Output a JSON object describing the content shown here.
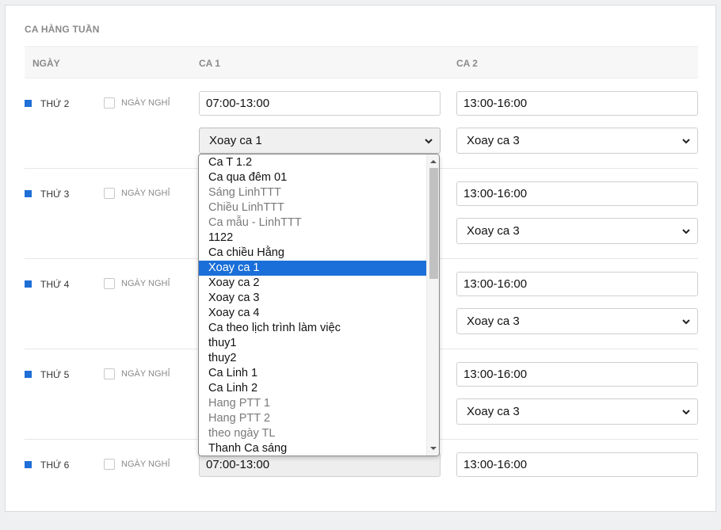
{
  "section_title": "CA HÀNG TUẦN",
  "columns": {
    "day": "NGÀY",
    "shift1": "CA 1",
    "shift2": "CA 2"
  },
  "off_label": "NGÀY NGHỈ",
  "days": [
    {
      "label": "THỨ 2",
      "shift1_time": "07:00-13:00",
      "shift2_time": "13:00-16:00",
      "shift1_select": "Xoay ca 1",
      "shift2_select": "Xoay ca 3"
    },
    {
      "label": "THỨ 3",
      "shift2_time": "13:00-16:00",
      "shift2_select": "Xoay ca 3"
    },
    {
      "label": "THỨ 4",
      "shift2_time": "13:00-16:00",
      "shift2_select": "Xoay ca 3"
    },
    {
      "label": "THỨ 5",
      "shift2_time": "13:00-16:00",
      "shift2_select": "Xoay ca 3"
    },
    {
      "label": "THỨ 6",
      "shift1_time": "07:00-13:00",
      "shift2_time": "13:00-16:00"
    }
  ],
  "dropdown_options": [
    {
      "label": "Ca T 1.2",
      "state": "normal"
    },
    {
      "label": "Ca qua đêm 01",
      "state": "normal"
    },
    {
      "label": "Sáng LinhTTT",
      "state": "dim"
    },
    {
      "label": "Chiều LinhTTT",
      "state": "dim"
    },
    {
      "label": "Ca mẫu - LinhTTT",
      "state": "dim"
    },
    {
      "label": "1122",
      "state": "normal"
    },
    {
      "label": "Ca chiều Hằng",
      "state": "normal"
    },
    {
      "label": "Xoay ca 1",
      "state": "selected"
    },
    {
      "label": "Xoay ca 2",
      "state": "normal"
    },
    {
      "label": "Xoay ca 3",
      "state": "normal"
    },
    {
      "label": "Xoay ca 4",
      "state": "normal"
    },
    {
      "label": "Ca theo lịch trình làm việc",
      "state": "normal"
    },
    {
      "label": "thuy1",
      "state": "normal"
    },
    {
      "label": "thuy2",
      "state": "normal"
    },
    {
      "label": "Ca Linh 1",
      "state": "normal"
    },
    {
      "label": "Ca Linh 2",
      "state": "normal"
    },
    {
      "label": "Hang PTT 1",
      "state": "dim"
    },
    {
      "label": "Hang PTT 2",
      "state": "dim"
    },
    {
      "label": "theo ngày TL",
      "state": "dim"
    },
    {
      "label": "Thanh Ca sáng",
      "state": "normal"
    }
  ],
  "colors": {
    "accent": "#1f6fd6",
    "selected_option": "#1a6fd8",
    "muted_text": "#8a8a8a"
  }
}
